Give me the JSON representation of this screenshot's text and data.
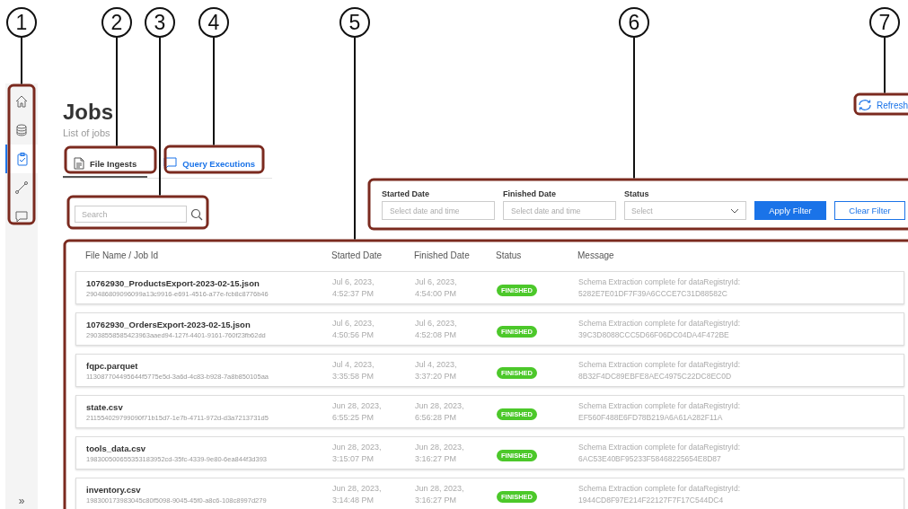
{
  "sidebar": {
    "items": [
      {
        "selected": false
      },
      {
        "selected": false
      },
      {
        "selected": true
      },
      {
        "selected": false
      },
      {
        "selected": false
      }
    ],
    "expand": "»"
  },
  "header": {
    "title": "Jobs",
    "subtitle": "List of jobs",
    "refresh": "Refresh"
  },
  "tabs": [
    {
      "label": "File Ingests",
      "selected": true
    },
    {
      "label": "Query Executions",
      "selected": false
    }
  ],
  "search": {
    "placeholder": "Search"
  },
  "filters": [
    {
      "label": "Started Date",
      "placeholder": "Select date and time",
      "kind": "date"
    },
    {
      "label": "Finished Date",
      "placeholder": "Select date and time",
      "kind": "date"
    },
    {
      "label": "Status",
      "placeholder": "Select",
      "kind": "select"
    }
  ],
  "filter_buttons": {
    "apply": "Apply Filter",
    "clear": "Clear Filter"
  },
  "table": {
    "columns": [
      "File Name / Job Id",
      "Started Date",
      "Finished Date",
      "Status",
      "Message"
    ],
    "rows": [
      {
        "name": "10762930_ProductsExport-2023-02-15.json",
        "job_id": "290486809096099a13c9916-e691-4516-a77e-fcb8c8776b46",
        "started": "Jul 6, 2023, 4:52:37 PM",
        "finished": "Jul 6, 2023, 4:54:00 PM",
        "status": "FINISHED",
        "message": "Schema Extraction complete for dataRegistryId: 5282E7E01DF7F39A6CCCE7C31D88582C"
      },
      {
        "name": "10762930_OrdersExport-2023-02-15.json",
        "job_id": "29038558585423963aaed94-127f-4401-9161-760f23fb62dd",
        "started": "Jul 6, 2023, 4:50:56 PM",
        "finished": "Jul 6, 2023, 4:52:08 PM",
        "status": "FINISHED",
        "message": "Schema Extraction complete for dataRegistryId: 39C3D8088CCC5D66F06DC04DA4F472BE"
      },
      {
        "name": "fqpc.parquet",
        "job_id": "113087704495644f5775e5d-3a6d-4c83-b928-7a8b850105aa",
        "started": "Jul 4, 2023, 3:35:58 PM",
        "finished": "Jul 4, 2023, 3:37:20 PM",
        "status": "FINISHED",
        "message": "Schema Extraction complete for dataRegistryId: 8B32F4DC89EBFE8AEC4975C22DC8EC0D"
      },
      {
        "name": "state.csv",
        "job_id": "211554029799090f71b15d7-1e7b-4711-972d-d3a7213731d5",
        "started": "Jun 28, 2023, 6:55:25 PM",
        "finished": "Jun 28, 2023, 6:56:28 PM",
        "status": "FINISHED",
        "message": "Schema Extraction complete for dataRegistryId: EF560F488E6FD78B219A6A61A282F11A"
      },
      {
        "name": "tools_data.csv",
        "job_id": "198300500655353183952cd-35fc-4339-9e80-6ea844f3d393",
        "started": "Jun 28, 2023, 3:15:07 PM",
        "finished": "Jun 28, 2023, 3:16:27 PM",
        "status": "FINISHED",
        "message": "Schema Extraction complete for dataRegistryId: 6AC53E40BF95233F58468225654E8D87"
      },
      {
        "name": "inventory.csv",
        "job_id": "198300173983045c80f5098-9045-45f0-a8c6-108c8997d279",
        "started": "Jun 28, 2023, 3:14:48 PM",
        "finished": "Jun 28, 2023, 3:16:27 PM",
        "status": "FINISHED",
        "message": "Schema Extraction complete for dataRegistryId: 1944CD8F97E214F22127F7F17C544DC4"
      }
    ]
  },
  "callouts": [
    {
      "number": "1"
    },
    {
      "number": "2"
    },
    {
      "number": "3"
    },
    {
      "number": "4"
    },
    {
      "number": "5"
    },
    {
      "number": "6"
    },
    {
      "number": "7"
    }
  ]
}
